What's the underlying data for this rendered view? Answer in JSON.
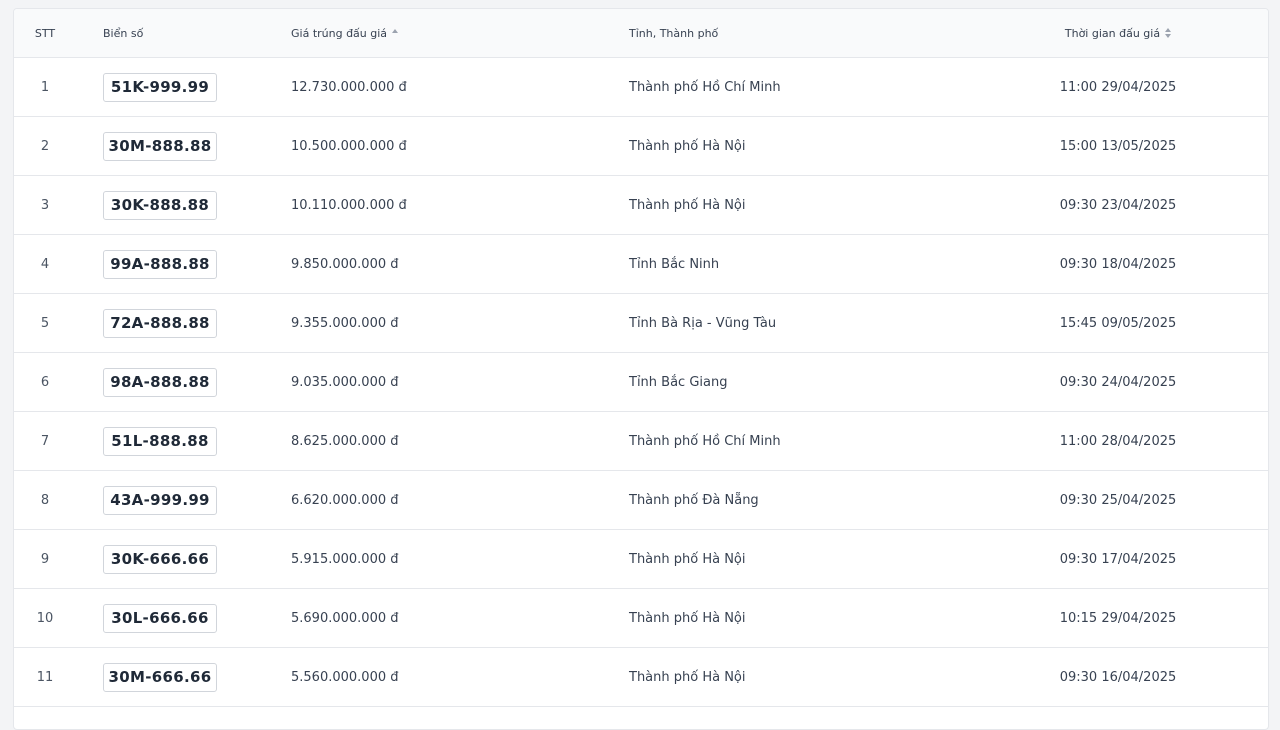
{
  "table": {
    "headers": {
      "stt": "STT",
      "plate": "Biển số",
      "price": "Giá trúng đấu giá",
      "province": "Tỉnh, Thành phố",
      "time": "Thời gian đấu giá"
    },
    "sort": {
      "price": "ascending-indicator",
      "time": "sortable-indicator"
    },
    "rows": [
      {
        "stt": "1",
        "plate": "51K-999.99",
        "price": "12.730.000.000 đ",
        "province": "Thành phố Hồ Chí Minh",
        "time": "11:00 29/04/2025"
      },
      {
        "stt": "2",
        "plate": "30M-888.88",
        "price": "10.500.000.000 đ",
        "province": "Thành phố Hà Nội",
        "time": "15:00 13/05/2025"
      },
      {
        "stt": "3",
        "plate": "30K-888.88",
        "price": "10.110.000.000 đ",
        "province": "Thành phố Hà Nội",
        "time": "09:30 23/04/2025"
      },
      {
        "stt": "4",
        "plate": "99A-888.88",
        "price": "9.850.000.000 đ",
        "province": "Tỉnh Bắc Ninh",
        "time": "09:30 18/04/2025"
      },
      {
        "stt": "5",
        "plate": "72A-888.88",
        "price": "9.355.000.000 đ",
        "province": "Tỉnh Bà Rịa - Vũng Tàu",
        "time": "15:45 09/05/2025"
      },
      {
        "stt": "6",
        "plate": "98A-888.88",
        "price": "9.035.000.000 đ",
        "province": "Tỉnh Bắc Giang",
        "time": "09:30 24/04/2025"
      },
      {
        "stt": "7",
        "plate": "51L-888.88",
        "price": "8.625.000.000 đ",
        "province": "Thành phố Hồ Chí Minh",
        "time": "11:00 28/04/2025"
      },
      {
        "stt": "8",
        "plate": "43A-999.99",
        "price": "6.620.000.000 đ",
        "province": "Thành phố Đà Nẵng",
        "time": "09:30 25/04/2025"
      },
      {
        "stt": "9",
        "plate": "30K-666.66",
        "price": "5.915.000.000 đ",
        "province": "Thành phố Hà Nội",
        "time": "09:30 17/04/2025"
      },
      {
        "stt": "10",
        "plate": "30L-666.66",
        "price": "5.690.000.000 đ",
        "province": "Thành phố Hà Nội",
        "time": "10:15 29/04/2025"
      },
      {
        "stt": "11",
        "plate": "30M-666.66",
        "price": "5.560.000.000 đ",
        "province": "Thành phố Hà Nội",
        "time": "09:30 16/04/2025"
      }
    ]
  }
}
